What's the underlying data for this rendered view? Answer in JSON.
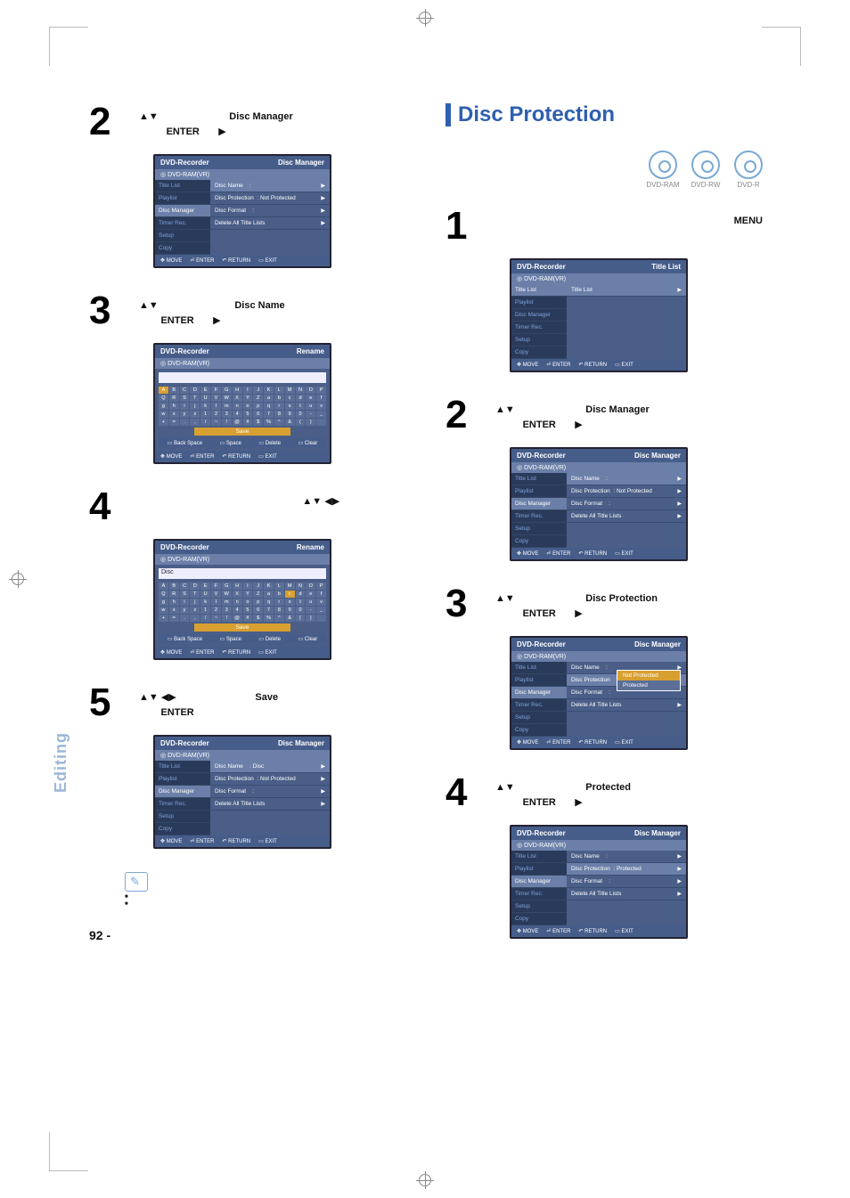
{
  "side_tab": "Editing",
  "page_number": "92 -",
  "left": {
    "steps": {
      "s2": {
        "num": "2",
        "target": "Disc Manager",
        "enter": "ENTER"
      },
      "s3": {
        "num": "3",
        "target": "Disc Name",
        "enter": "ENTER"
      },
      "s4": {
        "num": "4"
      },
      "s5": {
        "num": "5",
        "target": "Save",
        "enter": "ENTER"
      }
    },
    "notes": {
      "n1": "",
      "n2": ""
    }
  },
  "right": {
    "section_title": "Disc Protection",
    "discs": [
      "DVD-RAM",
      "DVD-RW",
      "DVD-R"
    ],
    "steps": {
      "s1": {
        "num": "1",
        "target": "MENU"
      },
      "s2": {
        "num": "2",
        "target": "Disc Manager",
        "enter": "ENTER"
      },
      "s3": {
        "num": "3",
        "target": "Disc Protection",
        "enter": "ENTER"
      },
      "s4": {
        "num": "4",
        "target": "Protected",
        "enter": "ENTER"
      }
    }
  },
  "osd": {
    "recorder": "DVD-Recorder",
    "mode": "DVD-RAM(VR)",
    "menu_items": [
      "Title List",
      "Playlist",
      "Disc Manager",
      "Timer Rec.",
      "Setup",
      "Copy"
    ],
    "headers": {
      "disc_manager": "Disc Manager",
      "rename": "Rename",
      "title_list": "Title List"
    },
    "dm_rows": {
      "name": "Disc Name",
      "name_val": ":",
      "name_val_disc": ": Disc",
      "prot": "Disc Protection",
      "prot_val": ": Not Protected",
      "prot_val_p": ": Protected",
      "format": "Disc Format",
      "format_val": ":",
      "delete": "Delete All Title Lists"
    },
    "title_list_row": "Title List",
    "popup": {
      "a": "Not Protected",
      "b": "Protected"
    },
    "kb_input_disc": "Disc",
    "kb_row1": [
      "A",
      "B",
      "C",
      "D",
      "E",
      "F",
      "G",
      "H",
      "I",
      "J",
      "K",
      "L",
      "M",
      "N",
      "O",
      "P"
    ],
    "kb_row2": [
      "Q",
      "R",
      "S",
      "T",
      "U",
      "V",
      "W",
      "X",
      "Y",
      "Z",
      "a",
      "b",
      "c",
      "d",
      "e",
      "f"
    ],
    "kb_row3": [
      "g",
      "h",
      "i",
      "j",
      "k",
      "l",
      "m",
      "n",
      "o",
      "p",
      "q",
      "r",
      "s",
      "t",
      "u",
      "v"
    ],
    "kb_row4": [
      "w",
      "x",
      "y",
      "z",
      "1",
      "2",
      "3",
      "4",
      "5",
      "6",
      "7",
      "8",
      "9",
      "0",
      "-",
      "_"
    ],
    "kb_row5": [
      "+",
      "=",
      ".",
      ",",
      "/",
      "~",
      "!",
      "@",
      "#",
      "$",
      "%",
      "^",
      "&",
      "(",
      ")",
      " "
    ],
    "kb_save": "Save",
    "kb_actions": [
      "Back Space",
      "Space",
      "Delete",
      "Clear"
    ],
    "footer": {
      "move": "MOVE",
      "enter": "ENTER",
      "return": "RETURN",
      "exit": "EXIT"
    }
  }
}
